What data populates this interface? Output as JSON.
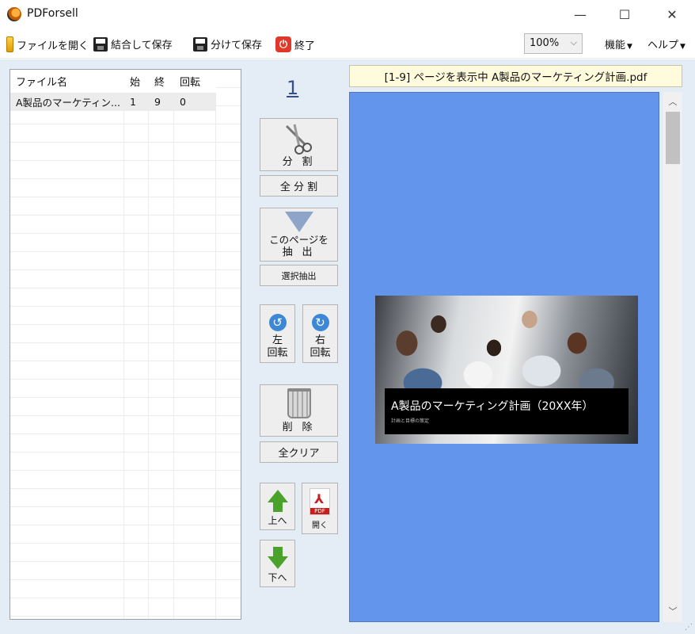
{
  "window": {
    "title": "PDForsell",
    "minimize": "—",
    "maximize": "☐",
    "close": "✕"
  },
  "menubar": {
    "open_file": "ファイルを開く",
    "merge_save": "結合して保存",
    "split_save": "分けて保存",
    "exit": "終了",
    "zoom": "100%",
    "features": "機能",
    "help": "ヘルプ"
  },
  "file_table": {
    "columns": [
      "ファイル名",
      "始",
      "終",
      "回転"
    ],
    "rows": [
      {
        "name": "A製品のマーケティン...",
        "start": "1",
        "end": "9",
        "rotation": "0"
      }
    ]
  },
  "controls": {
    "page_number": "1",
    "split": "分 割",
    "split_all": "全 分 割",
    "extract_line1": "このページを",
    "extract_line2": "抽 出",
    "select_extract": "選択抽出",
    "rotate_left_1": "左",
    "rotate_left_2": "回転",
    "rotate_right_1": "右",
    "rotate_right_2": "回転",
    "delete": "削 除",
    "clear_all": "全クリア",
    "move_up": "上へ",
    "open": "開く",
    "move_down": "下へ"
  },
  "preview": {
    "status": "[1-9] ページを表示中  A製品のマーケティング計画.pdf",
    "slide_title": "A製品のマーケティング計画（20XX年）",
    "slide_subtitle": "計画と目標の策定"
  }
}
